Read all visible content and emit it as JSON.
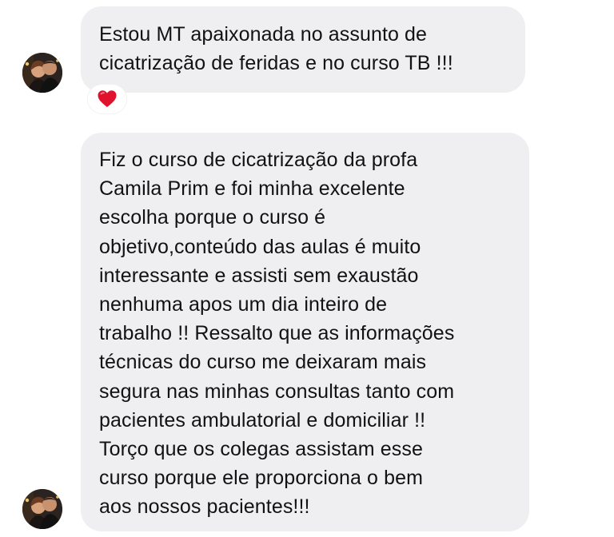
{
  "messages": [
    {
      "lines": [
        "Estou MT apaixonada no assunto de",
        "cicatrização de feridas e no curso TB !!!"
      ],
      "reaction": "red-heart-icon"
    },
    {
      "lines": [
        "Fiz o curso de cicatrização da profa",
        "Camila Prim e foi minha excelente",
        "escolha porque o curso é",
        "objetivo,conteúdo das aulas é muito",
        "interessante e assisti sem exaustão",
        "nenhuma apos um dia inteiro de",
        "trabalho !! Ressalto que as informações",
        "técnicas do curso me deixaram mais",
        "segura nas minhas consultas tanto com",
        "pacientes ambulatorial e domiciliar !!",
        "Torço que os colegas assistam esse",
        "curso porque ele proporciona o bem",
        "aos nossos pacientes!!!"
      ]
    }
  ],
  "colors": {
    "bubble_background": "#efeff1",
    "text": "#121212",
    "reaction_heart": "#e0122d"
  }
}
